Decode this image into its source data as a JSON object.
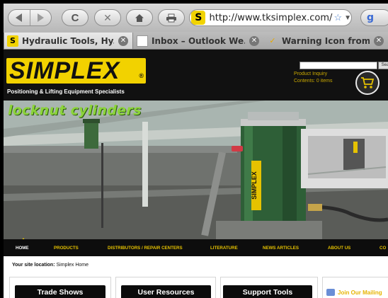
{
  "browser": {
    "url": "http://www.tksimplex.com/",
    "site_icon_letter": "S",
    "google_icon_letter": "g",
    "tabs": [
      {
        "label": "Hydraulic Tools, Hy...",
        "favicon": "simplex-s-icon",
        "active": true
      },
      {
        "label": "Inbox – Outlook We...",
        "favicon": "document-icon",
        "active": false
      },
      {
        "label": "Warning Icon from ...",
        "favicon": "checkmark-icon",
        "active": false
      }
    ],
    "close_glyph": "✕",
    "reload_glyph": "C",
    "stop_glyph": "✕",
    "star_glyph": "☆",
    "dropdown_glyph": "▼"
  },
  "site": {
    "logo": "SIMPLEX",
    "logo_mark": "®",
    "tagline": "Positioning & Lifting Equipment Specialists",
    "search_button": "Sea",
    "product_inquiry": "Product Inquiry",
    "contents": "Contents: 0 items"
  },
  "hero": {
    "title": "locknut cylinders",
    "cylinder_brand": "SIMPLEX"
  },
  "nav": {
    "items": [
      "HOME",
      "PRODUCTS",
      "DISTRIBUTORS / REPAIR CENTERS",
      "LITERATURE",
      "NEWS ARTICLES",
      "ABOUT US",
      "CO"
    ]
  },
  "location": {
    "label": "Your site location:",
    "value": "Simplex Home"
  },
  "panels": {
    "trade_shows": "Trade Shows",
    "user_resources": "User Resources",
    "support_tools": "Support Tools",
    "mailing_list": "Join Our Mailing"
  },
  "colors": {
    "brand_yellow": "#f2d200",
    "nav_yellow": "#e6c200",
    "hero_green": "#8cd43a"
  }
}
